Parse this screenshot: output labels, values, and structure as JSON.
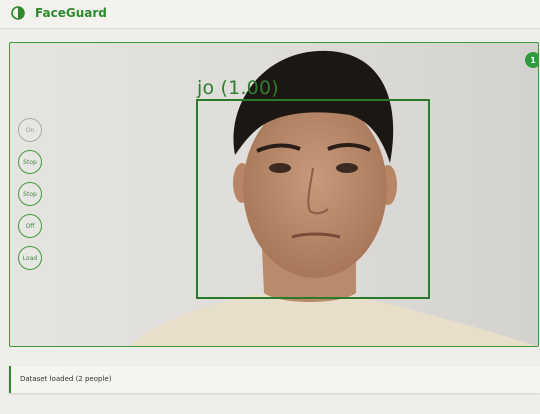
{
  "header": {
    "app_title": "FaceGuard",
    "logo_icon": "half-circle-icon",
    "accent": "#2d8a2d"
  },
  "viewer": {
    "detection": {
      "label": "jo (1.00)"
    },
    "face_count": "1",
    "controls": [
      {
        "label": "On",
        "enabled": false
      },
      {
        "label": "Stop",
        "enabled": true
      },
      {
        "label": "Stop",
        "enabled": true
      },
      {
        "label": "Off",
        "enabled": true
      },
      {
        "label": "Load",
        "enabled": true
      }
    ]
  },
  "status": {
    "message": "Dataset loaded (2 people)"
  }
}
